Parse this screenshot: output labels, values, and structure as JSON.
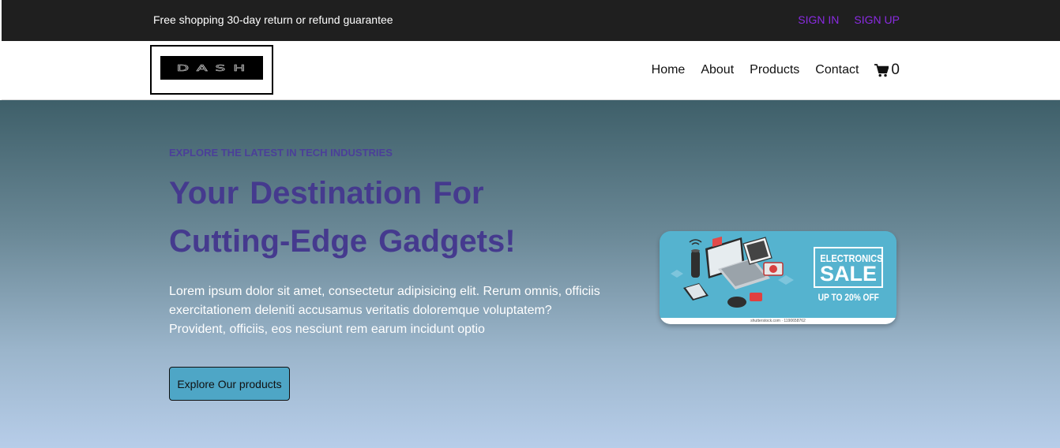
{
  "topbar": {
    "promo_text": "Free shopping 30-day return or refund guarantee",
    "sign_in": "SIGN IN",
    "sign_up": "SIGN UP"
  },
  "navbar": {
    "logo_text": "DASH",
    "links": [
      "Home",
      "About",
      "Products",
      "Contact"
    ],
    "cart_icon": "shopping-cart-icon",
    "cart_count": "0"
  },
  "hero": {
    "eyebrow": "EXPLORE THE LATEST IN TECH INDUSTRIES",
    "headline": "Your Destination For Cutting-Edge Gadgets!",
    "lead": "Lorem ipsum dolor sit amet, consectetur adipisicing elit. Rerum omnis, officiis exercitationem deleniti accusamus veritatis doloremque voluptatem? Provident, officiis, eos nesciunt rem earum incidunt optio",
    "cta_label": "Explore Our products"
  },
  "promo_image": {
    "title_line1": "ELECTRONICS",
    "title_line2": "SALE",
    "subtitle": "UP TO 20% OFF",
    "credit": "shutterstock.com · 1190658762"
  },
  "colors": {
    "topbar_bg": "#1f1f1f",
    "auth_links": "#8a2be2",
    "headline": "#453a8e",
    "cta_bg": "#4ea6c6",
    "promo_bg": "#55b3cf"
  }
}
